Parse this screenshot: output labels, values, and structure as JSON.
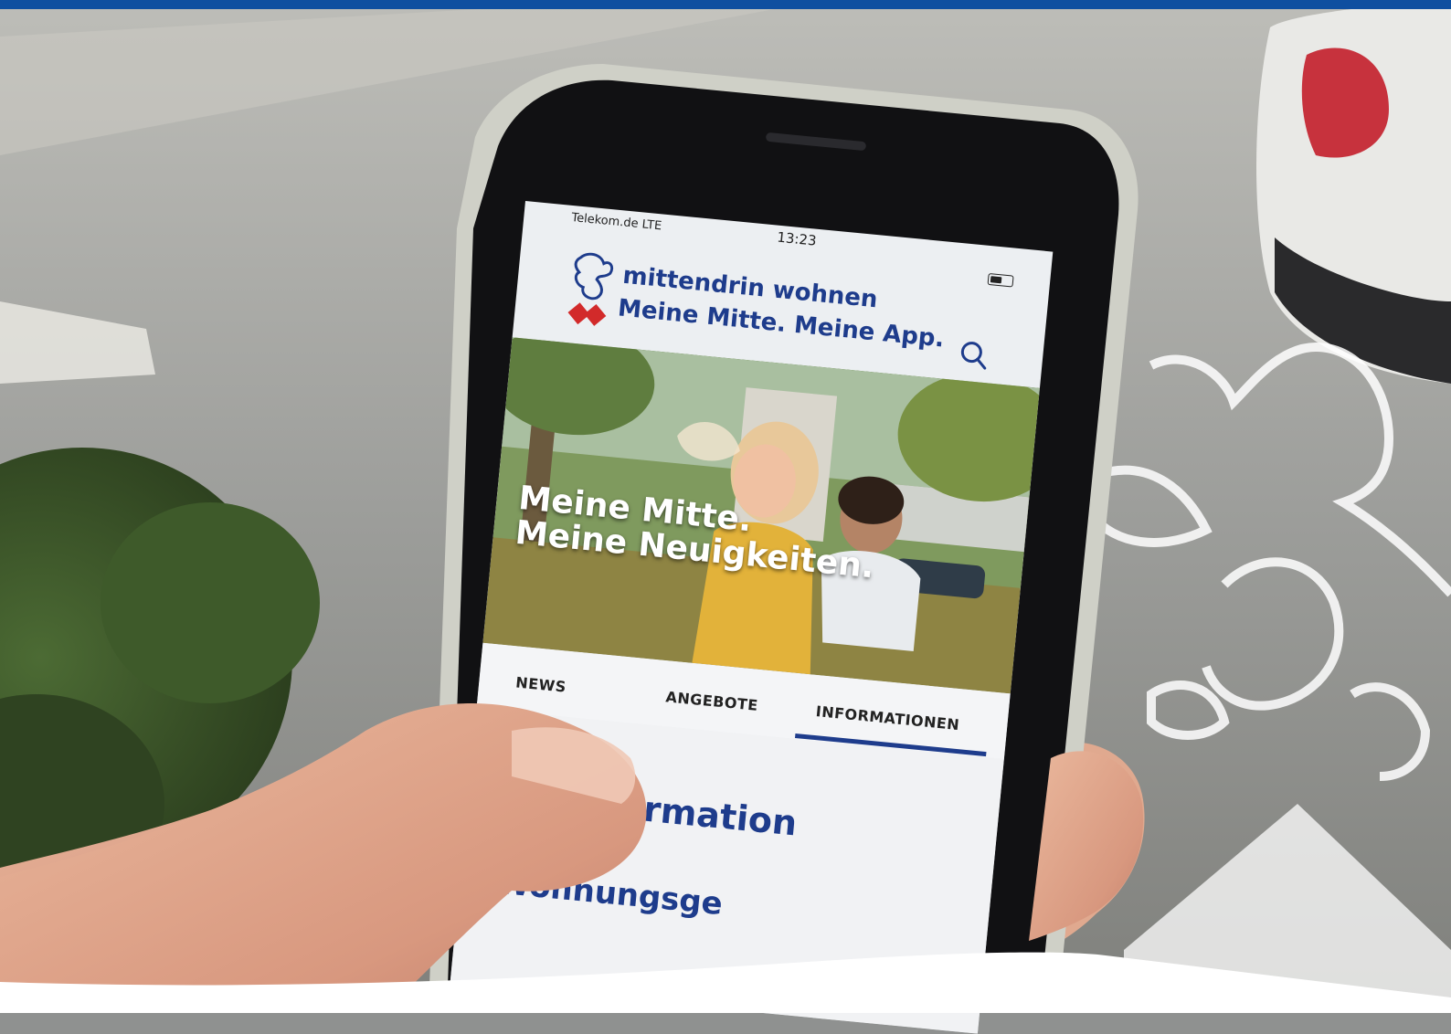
{
  "status_bar": {
    "carrier": "Telekom.de  LTE",
    "time": "13:23"
  },
  "app": {
    "brand_name": "mittendrin wohnen",
    "slogan": "Meine Mitte. Meine App."
  },
  "hero": {
    "line1": "Meine Mitte.",
    "line2": "Meine Neuigkeiten."
  },
  "tabs": [
    {
      "label": "NEWS"
    },
    {
      "label": "ANGEBOTE"
    },
    {
      "label": "INFORMATIONEN"
    }
  ],
  "content": {
    "heading": "formation",
    "subheading": "Wohnungsge"
  },
  "colors": {
    "brand_blue": "#1e3c8c",
    "brand_red": "#d22a2a",
    "top_bar": "#0f4fa0"
  },
  "icons": [
    "search-icon",
    "lion-logo-icon",
    "diamond-logo-icon",
    "lion-watermark-icon"
  ]
}
